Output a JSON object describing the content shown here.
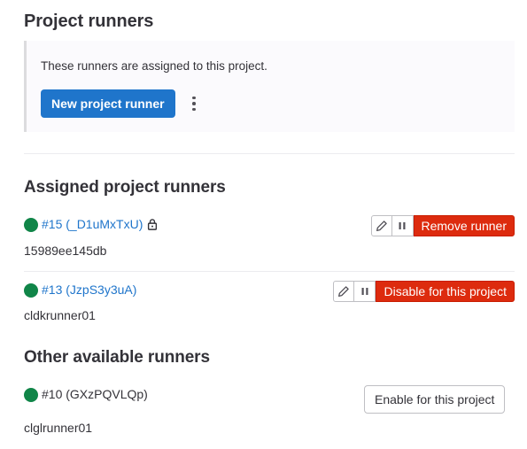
{
  "page_title": "Project runners",
  "info_box": {
    "text": "These runners are assigned to this project.",
    "new_button_label": "New project runner",
    "more_icon": "vertical-ellipsis-icon"
  },
  "assigned_section": {
    "title": "Assigned project runners",
    "runners": [
      {
        "id_label": "#15 (_D1uMxTxU)",
        "locked": true,
        "description": "15989ee145db",
        "status_color": "#108548",
        "edit_icon": "pencil-icon",
        "pause_icon": "pause-icon",
        "action_label": "Remove runner"
      },
      {
        "id_label": "#13 (JzpS3y3uA)",
        "locked": false,
        "description": "cldkrunner01",
        "status_color": "#108548",
        "edit_icon": "pencil-icon",
        "pause_icon": "pause-icon",
        "action_label": "Disable for this project"
      }
    ]
  },
  "other_section": {
    "title": "Other available runners",
    "runners": [
      {
        "id_label": "#10 (GXzPQVLQp)",
        "description": "clglrunner01",
        "status_color": "#108548",
        "action_label": "Enable for this project"
      }
    ]
  },
  "colors": {
    "primary": "#1f75cb",
    "danger": "#dd2b0e",
    "status_online": "#108548"
  }
}
